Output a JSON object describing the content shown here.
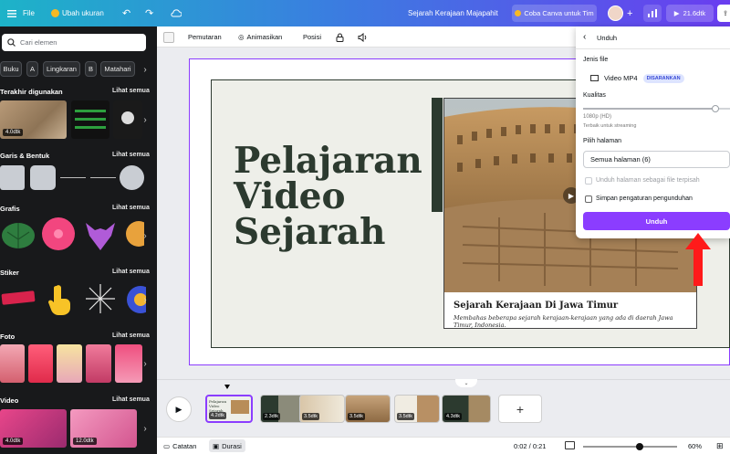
{
  "topbar": {
    "file_label": "File",
    "resize_label": "Ubah ukuran",
    "doc_title": "Sejarah Kerajaan Majapahit",
    "try_label": "Coba Canva untuk Tim",
    "play_label": "21.6dtk"
  },
  "sidebar": {
    "search_placeholder": "Cari elemen",
    "chips": [
      "Buku",
      "A",
      "Lingkaran",
      "B",
      "Matahari"
    ],
    "see_all": "Lihat semua",
    "sections": [
      {
        "title": "Terakhir digunakan",
        "badge": "4.0dtk"
      },
      {
        "title": "Garis & Bentuk"
      },
      {
        "title": "Grafis"
      },
      {
        "title": "Stiker"
      },
      {
        "title": "Foto"
      },
      {
        "title": "Video",
        "badges": [
          "4.0dtk",
          "12.0dtk"
        ]
      }
    ]
  },
  "toolbar": {
    "transition": "Pemutaran",
    "animate": "Animasikan",
    "position": "Posisi"
  },
  "slide": {
    "title_lines": [
      "Pelajaran",
      "Video",
      "Sejarah"
    ],
    "caption_title": "Sejarah Kerajaan Di Jawa Timur",
    "caption_sub": "Membahas beberapa sejarah kerajaan-kerajaan yang ada di daerah Jawa Timur, Indonesia."
  },
  "download_panel": {
    "header": "Unduh",
    "file_type_label": "Jenis file",
    "file_type_value": "Video MP4",
    "recommended": "DISARANKAN",
    "quality_label": "Kualitas",
    "quality_value": "1080p (HD)",
    "quality_note": "Terbaik untuk streaming",
    "quality_level": 0.9,
    "pages_label": "Pilih halaman",
    "pages_value": "Semua halaman (6)",
    "separate_files": "Unduh halaman sebagai file terpisah",
    "save_settings": "Simpan pengaturan pengunduhan",
    "download_button": "Unduh"
  },
  "timeline": {
    "pages": [
      {
        "badge": "4.2dtk",
        "label": "Pelajaran Video Sejarah"
      },
      {
        "badge": "2.3dtk"
      },
      {
        "badge": "3.5dtk"
      },
      {
        "badge": "3.5dtk"
      },
      {
        "badge": "3.5dtk"
      },
      {
        "badge": "4.3dtk"
      }
    ]
  },
  "bottombar": {
    "notes": "Catatan",
    "duration": "Durasi",
    "time": "0:02 / 0:21",
    "zoom": "60%",
    "zoom_level": 0.6
  },
  "colors": {
    "accent": "#8b3dff",
    "slide_green": "#2c3a2f",
    "arrow_red": "#ff1a1a"
  }
}
